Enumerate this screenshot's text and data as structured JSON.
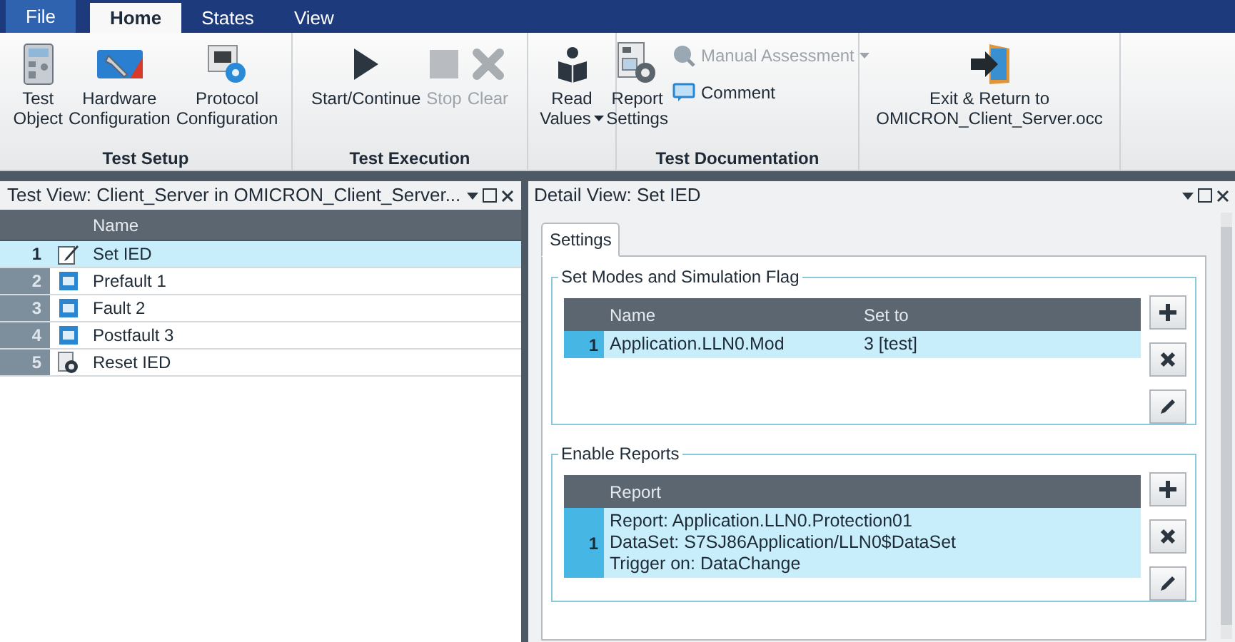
{
  "menu_tabs": [
    {
      "label": "File",
      "kind": "file"
    },
    {
      "label": "Home",
      "kind": "tab",
      "selected": true
    },
    {
      "label": "States",
      "kind": "tab",
      "selected": false
    },
    {
      "label": "View",
      "kind": "tab",
      "selected": false
    }
  ],
  "ribbon_groups": [
    {
      "title": "Test Setup",
      "items": [
        {
          "kind": "large",
          "lines": [
            "Test",
            "Object"
          ],
          "disabled": false
        },
        {
          "kind": "large",
          "lines": [
            "Hardware",
            "Configuration"
          ],
          "disabled": false
        },
        {
          "kind": "large",
          "lines": [
            "Protocol",
            "Configuration"
          ],
          "disabled": false
        }
      ]
    },
    {
      "title": "Test Execution",
      "items": [
        {
          "kind": "large",
          "lines": [
            "Start/Continue"
          ],
          "disabled": false
        },
        {
          "kind": "large",
          "lines": [
            "Stop"
          ],
          "disabled": true
        },
        {
          "kind": "large",
          "lines": [
            "Clear"
          ],
          "disabled": true
        }
      ]
    },
    {
      "items": [
        {
          "kind": "large",
          "lines": [
            "Read",
            "Values"
          ],
          "disabled": false,
          "dropdown": true
        }
      ]
    },
    {
      "title": "Test Documentation",
      "items": [
        {
          "kind": "large",
          "lines": [
            "Report",
            "Settings"
          ],
          "disabled": false
        },
        {
          "kind": "small",
          "lines": [
            "Manual Assessment"
          ],
          "disabled": true,
          "dropdown": true
        },
        {
          "kind": "small",
          "lines": [
            "Comment"
          ],
          "disabled": false
        }
      ]
    },
    {
      "items": [
        {
          "kind": "large",
          "lines": [
            "Exit & Return to",
            "OMICRON_Client_Server.occ"
          ],
          "disabled": false
        }
      ]
    }
  ],
  "test_view": {
    "title": "Test View: Client_Server in OMICRON_Client_Server...",
    "column": "Name",
    "rows": [
      {
        "number": "1",
        "name": "Set IED",
        "kind": "edit",
        "selected": true
      },
      {
        "number": "2",
        "name": "Prefault 1",
        "kind": "state",
        "selected": false
      },
      {
        "number": "3",
        "name": "Fault 2",
        "kind": "state",
        "selected": false
      },
      {
        "number": "4",
        "name": "Postfault 3",
        "kind": "state",
        "selected": false
      },
      {
        "number": "5",
        "name": "Reset IED",
        "kind": "reset",
        "selected": false
      }
    ]
  },
  "detail_view": {
    "title": "Detail View: Set IED",
    "tabs": [
      {
        "label": "Settings",
        "selected": true
      }
    ],
    "groups": [
      {
        "title": "Set Modes and Simulation Flag",
        "columns": [
          "Name",
          "Set to"
        ],
        "rows": [
          {
            "number": "1",
            "cells": [
              "Application.LLN0.Mod",
              "3 [test]"
            ],
            "selected": true
          }
        ]
      },
      {
        "title": "Enable Reports",
        "columns": [
          "Report"
        ],
        "rows": [
          {
            "number": "1",
            "cells": [
              "Report: Application.LLN0.Protection01\nDataSet: S7SJ86Application/LLN0$DataSet\nTrigger on: DataChange"
            ],
            "selected": true
          }
        ]
      }
    ]
  }
}
